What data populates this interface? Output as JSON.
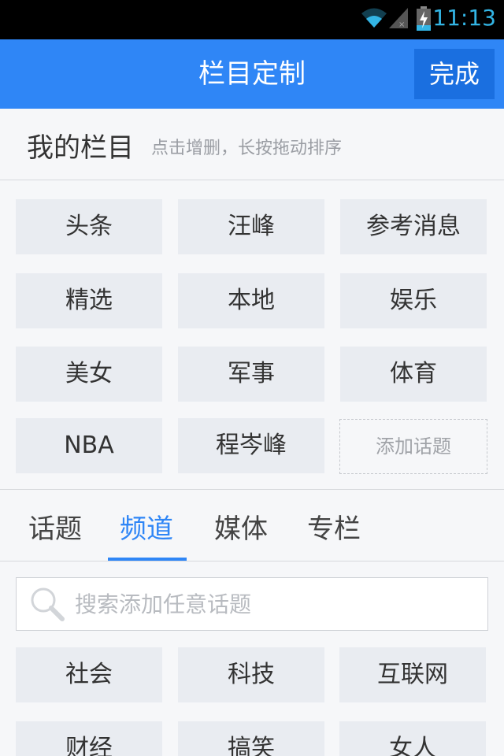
{
  "status_bar": {
    "time": "11:13"
  },
  "header": {
    "title": "栏目定制",
    "done_label": "完成"
  },
  "my_columns": {
    "heading": "我的栏目",
    "hint": "点击增删，长按拖动排序",
    "items": [
      "头条",
      "汪峰",
      "参考消息",
      "精选",
      "本地",
      "娱乐",
      "美女",
      "军事",
      "体育",
      "NBA",
      "程岑峰"
    ],
    "add_topic_label": "添加话题"
  },
  "tabs": {
    "items": [
      "话题",
      "频道",
      "媒体",
      "专栏"
    ],
    "active_index": 1
  },
  "search": {
    "placeholder": "搜索添加任意话题"
  },
  "channels": {
    "items": [
      "社会",
      "科技",
      "互联网",
      "财经",
      "搞笑",
      "女人"
    ]
  },
  "colors": {
    "accent": "#2f86f6",
    "done_bg": "#1a6fe0",
    "tile_bg": "#e9ecf1"
  }
}
